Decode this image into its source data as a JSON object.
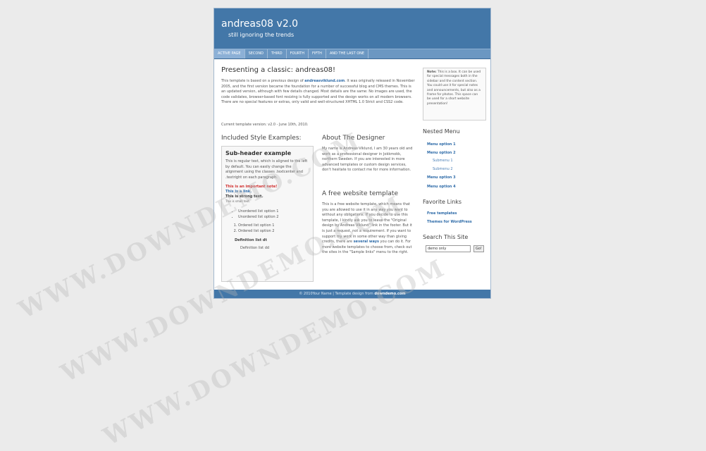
{
  "site": {
    "title": "andreas08 v2.0",
    "slogan": "still ignoring the trends"
  },
  "menu": {
    "items": [
      {
        "label": "ACTIVE PAGE",
        "active": true
      },
      {
        "label": "SECOND",
        "active": false
      },
      {
        "label": "THIRD",
        "active": false
      },
      {
        "label": "FOURTH",
        "active": false
      },
      {
        "label": "FIFTH",
        "active": false
      },
      {
        "label": "AND THE LAST ONE",
        "active": false
      }
    ]
  },
  "main": {
    "heading": "Presenting a classic: andreas08!",
    "intro_before_link": "This template is based on a previous design of ",
    "intro_link": "andreasviklund.com",
    "intro_after_link": ". It was originally released in November 2005, and the first version became the foundation for a number of successful blog and CMS themes. This is an updated version, although with few details changed. Most details are the same: No images are used, the code validates, browser-based font resizing is fully supported and the design works on all modern browsers. There are no special features or extras, only valid and well-structured XHTML 1.0 Strict and CSS2 code.",
    "version_text": "Current template version: v2.0 - June 10th, 2010.",
    "styles_heading": "Included Style Examples:",
    "style_box": {
      "sub_header": "Sub-header example",
      "paragraph": "This is regular text, which is aligned to the left by default. You can easily change the alignment using the classes .textcenter and .textright on each paragraph.",
      "important_note": "This is an important note!",
      "link": "This is a link.",
      "strong": "This is strong text.",
      "small": "This is small text.",
      "unordered": [
        "Unordered list option 1",
        "Unordered list option 2"
      ],
      "ordered": [
        "Ordered list option 1",
        "Ordered list option 2"
      ],
      "definition_dt": "Definition list dt",
      "definition_dd": "Definition list dd"
    },
    "designer_heading": "About The Designer",
    "designer_text": "My name is Andreas Viklund, I am 30 years old and work as a professional designer in Jokkmokk, northern Sweden. If you are interested in more advanced templates or custom design services, don't hesitate to contact me for more information.",
    "free_heading": "A free website template",
    "free_text_before": "This is a free website template, which means that you are allowed to use it in any way you want to without any obligations. If you decide to use this template, I kindly ask you to leave the \"Original design by Andreas Viklund\" link in the footer. But it is just a request, not a requirement. If you want to support my work in some other way than giving credits, there are ",
    "free_link": "several ways",
    "free_text_after": " you can do it. For more website templates to choose from, check out the sites in the \"Sample links\" menu to the right."
  },
  "sidebar": {
    "note_label": "Note:",
    "note_text": " This is a box. It can be used for special messages both in the sidebar and the content section. You could use it for special notes and announcements, but also as a frame for photos. This space can be used for a short website presentation!",
    "nested_heading": "Nested Menu",
    "nested_items": [
      {
        "label": "Menu option 1",
        "sub": false
      },
      {
        "label": "Menu option 2",
        "sub": false
      },
      {
        "label": "Submenu 1",
        "sub": true
      },
      {
        "label": "Submenu 2",
        "sub": true
      },
      {
        "label": "Menu option 3",
        "sub": false
      },
      {
        "label": "Menu option 4",
        "sub": false
      }
    ],
    "favorite_heading": "Favorite Links",
    "favorite_items": [
      "Free templates",
      "Themes for WordPress"
    ],
    "search_heading": "Search This Site",
    "search_value": "demo only",
    "search_button": "Go!"
  },
  "footer": {
    "text": "© 2010Your Name | Template design from ",
    "brand": "downdemo.com"
  },
  "watermark": {
    "text": "WWW.DOWNDEMO.COM"
  }
}
